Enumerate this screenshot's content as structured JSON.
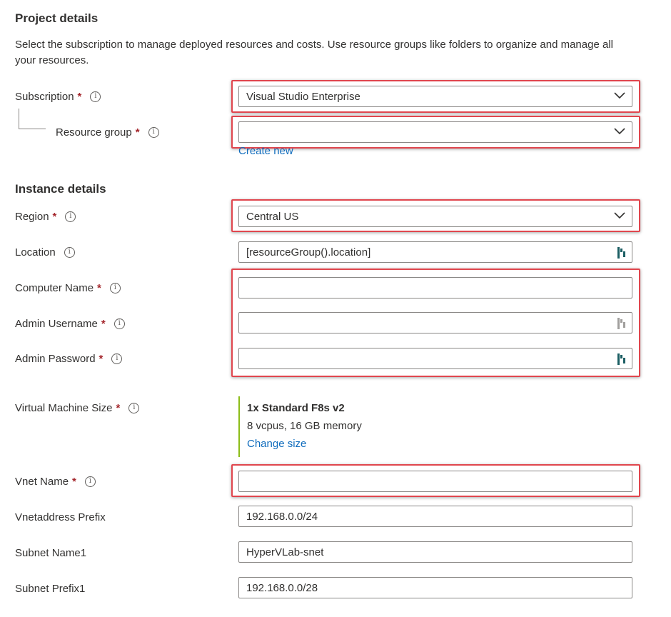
{
  "project": {
    "heading": "Project details",
    "description": "Select the subscription to manage deployed resources and costs. Use resource groups like folders to organize and manage all your resources.",
    "subscription": {
      "label": "Subscription",
      "required": "*",
      "value": "Visual Studio Enterprise"
    },
    "resource_group": {
      "label": "Resource group",
      "required": "*",
      "value": "",
      "create_new": "Create new"
    }
  },
  "instance": {
    "heading": "Instance details",
    "region": {
      "label": "Region",
      "required": "*",
      "value": "Central US"
    },
    "location": {
      "label": "Location",
      "value": "[resourceGroup().location]"
    },
    "computer_name": {
      "label": "Computer Name",
      "required": "*",
      "value": ""
    },
    "admin_username": {
      "label": "Admin Username",
      "required": "*",
      "value": ""
    },
    "admin_password": {
      "label": "Admin Password",
      "required": "*",
      "value": ""
    },
    "vm_size": {
      "label": "Virtual Machine Size",
      "required": "*",
      "size_name": "1x Standard F8s v2",
      "size_detail": "8 vcpus, 16 GB memory",
      "change_link": "Change size"
    },
    "vnet_name": {
      "label": "Vnet Name",
      "required": "*",
      "value": ""
    },
    "vnet_prefix": {
      "label": "Vnetaddress Prefix",
      "value": "192.168.0.0/24"
    },
    "subnet_name": {
      "label": "Subnet Name1",
      "value": "HyperVLab-snet"
    },
    "subnet_prefix": {
      "label": "Subnet Prefix1",
      "value": "192.168.0.0/28"
    }
  },
  "icons": {
    "info": "info-icon",
    "chevron": "chevron-down-icon",
    "keyvault": "keyvault-icon"
  },
  "colors": {
    "required": "#a4262c",
    "link": "#0f6cbd",
    "highlight": "#e0464e",
    "size_accent": "#8cbd18"
  }
}
